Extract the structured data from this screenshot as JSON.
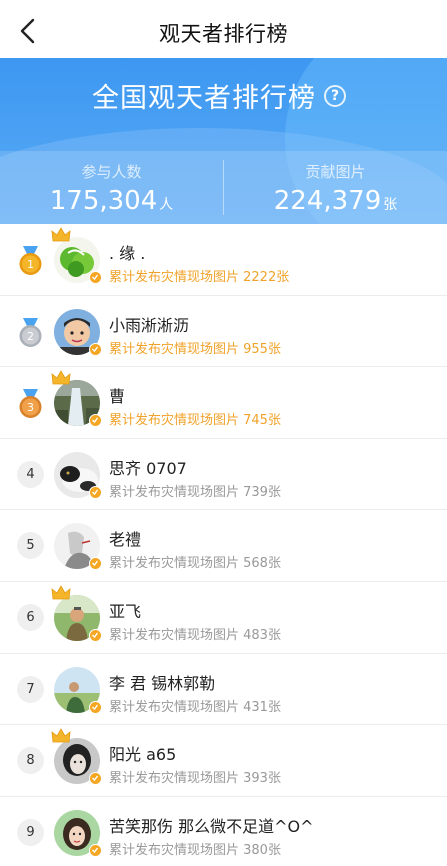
{
  "nav": {
    "title": "观天者排行榜"
  },
  "banner": {
    "title": "全国观天者排行榜",
    "participants_label": "参与人数",
    "participants_value": "175,304",
    "participants_unit": "人",
    "contributions_label": "贡献图片",
    "contributions_value": "224,379",
    "contributions_unit": "张"
  },
  "colors": {
    "banner_blue": "#3d98f2",
    "gold_text": "#f0a22a",
    "gray_text": "#999999"
  },
  "ranking": [
    {
      "rank": "1",
      "name": ". 缘 .",
      "desc": "累计发布灾情现场图片 2222张",
      "medal": "gold",
      "crown": true
    },
    {
      "rank": "2",
      "name": "小雨淅淅沥",
      "desc": "累计发布灾情现场图片 955张",
      "medal": "silver",
      "crown": false
    },
    {
      "rank": "3",
      "name": "曹",
      "desc": "累计发布灾情现场图片 745张",
      "medal": "bronze",
      "crown": true
    },
    {
      "rank": "4",
      "name": "思齐 0707",
      "desc": "累计发布灾情现场图片 739张",
      "medal": "",
      "crown": false
    },
    {
      "rank": "5",
      "name": "老禮",
      "desc": "累计发布灾情现场图片 568张",
      "medal": "",
      "crown": false
    },
    {
      "rank": "6",
      "name": "亚飞",
      "desc": "累计发布灾情现场图片 483张",
      "medal": "",
      "crown": true
    },
    {
      "rank": "7",
      "name": "李  君   锡林郭勒",
      "desc": "累计发布灾情现场图片 431张",
      "medal": "",
      "crown": false
    },
    {
      "rank": "8",
      "name": "阳光 a65",
      "desc": "累计发布灾情现场图片 393张",
      "medal": "",
      "crown": true
    },
    {
      "rank": "9",
      "name": "苦笑那伤   那么微不足道^O^",
      "desc": "累计发布灾情现场图片 380张",
      "medal": "",
      "crown": false
    }
  ]
}
